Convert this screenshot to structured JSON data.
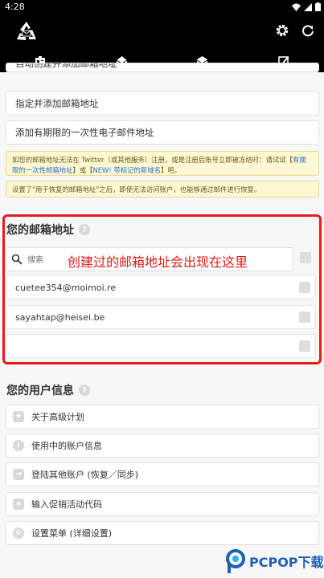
{
  "status_bar": {
    "time": "4:28"
  },
  "app_bar": {
    "logo_icon": "recycle-mail-logo",
    "actions": [
      "gear-icon",
      "refresh-icon"
    ],
    "tabs": [
      "id-card-icon",
      "mail-open-icon",
      "mail-closed-icon",
      "edit-icon"
    ]
  },
  "top_buttons": {
    "partial_label": "自动创建并添加邮箱地址",
    "specify_add": "指定并添加邮箱地址",
    "limited": "添加有期限的一次性电子邮件地址"
  },
  "notice1": {
    "text_a": "如您的邮箱地址无法在 Twitter（或其他服务）注册，或是注册后账号立即被冻结时：请试试【",
    "link_a": "有期限的一次性邮箱地址",
    "text_b": "】或【",
    "link_b": "NEW! 带标记的新域名",
    "text_c": "】吧。"
  },
  "notice2": {
    "text": "设置了\"用于恢复的邮箱地址\"之后，即使无法访问账户，也能够通过邮件进行恢复。"
  },
  "mail_section": {
    "title": "您的邮箱地址",
    "search_placeholder": "搜索",
    "overlay_note": "创建过的邮箱地址会出现在这里",
    "addresses": [
      "cuetee354@moimoi.re",
      "sayahtap@heisei.be",
      ""
    ]
  },
  "user_section": {
    "title": "您的用户信息",
    "items": [
      "关于高级计划",
      "使用中的账户信息",
      "登陆其他账户 (恢复／同步)",
      "输入促销活动代码",
      "设置菜单 (详细设置)"
    ]
  },
  "watermark": {
    "text": "PCPOP下载"
  },
  "colors": {
    "accent_red": "#e31c1c",
    "warn_bg": "#fdf7d4",
    "link_blue": "#2b73c9"
  }
}
